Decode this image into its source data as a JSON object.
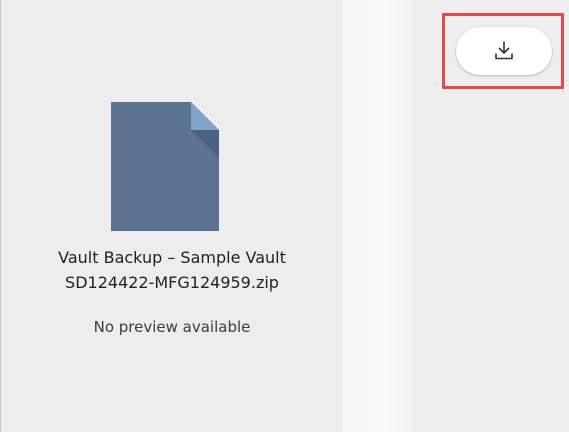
{
  "preview": {
    "file_name_line1": "Vault Backup – Sample Vault",
    "file_name_line2": "SD124422-MFG124959.zip",
    "no_preview_text": "No preview available",
    "file_icon": "document-file-icon",
    "file_icon_color": "#5b7391",
    "file_icon_fold_color": "#7fa6c9"
  },
  "toolbar": {
    "download_icon": "download-icon",
    "highlight_color": "#e5484d"
  }
}
